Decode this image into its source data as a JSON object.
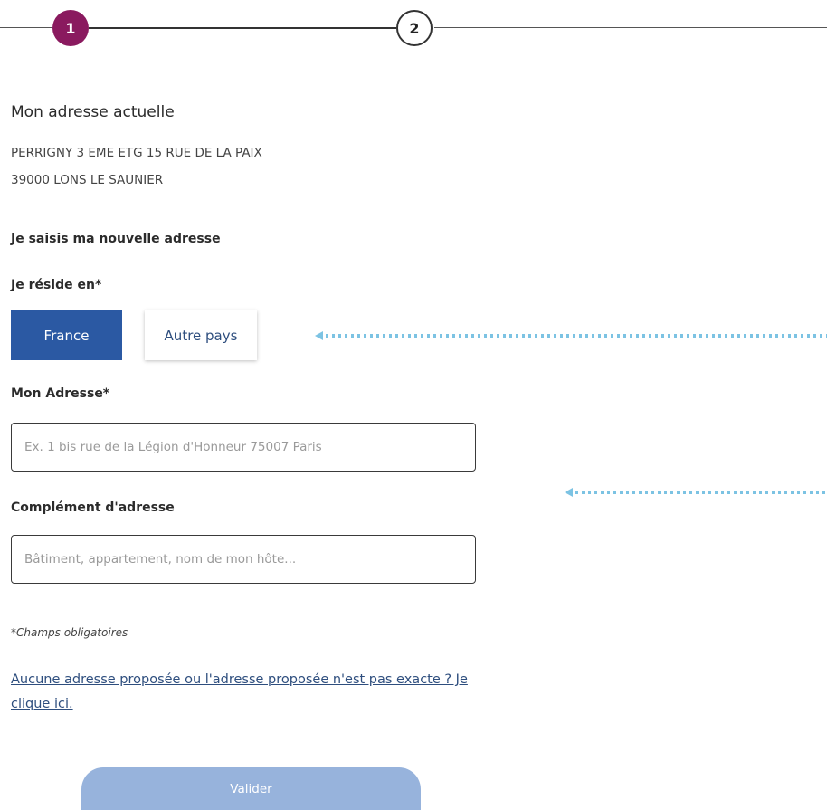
{
  "stepper": {
    "step1": "1",
    "step2": "2",
    "active_color": "#8a1a5f"
  },
  "current_address": {
    "title": "Mon adresse actuelle",
    "line1": "PERRIGNY 3 EME ETG 15 RUE DE LA PAIX",
    "line2": "39000 LONS LE SAUNIER"
  },
  "new_address": {
    "heading": "Je saisis ma nouvelle adresse",
    "reside_label": "Je réside en*",
    "country_options": {
      "france": "France",
      "other": "Autre pays"
    },
    "selected_country": "France",
    "address_label": "Mon Adresse*",
    "address_placeholder": "Ex. 1 bis rue de la Légion d'Honneur 75007 Paris",
    "address_value": "",
    "complement_label": "Complément d'adresse",
    "complement_placeholder": "Bâtiment, appartement, nom de mon hôte...",
    "complement_value": ""
  },
  "required_note": "*Champs obligatoires",
  "help_link": "Aucune adresse proposée ou l'adresse proposée n'est pas exacte ? Je clique ici.",
  "submit_label": "Valider",
  "colors": {
    "primary_blue": "#2b59a3",
    "link_blue": "#2e4e7e",
    "disabled_button": "#97b3dc",
    "annotation_arrow": "#7cc3e3"
  }
}
